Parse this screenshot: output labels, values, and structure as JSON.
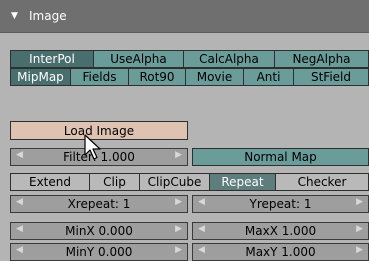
{
  "panel": {
    "title": "Image"
  },
  "row1": [
    "InterPol",
    "UseAlpha",
    "CalcAlpha",
    "NegAlpha"
  ],
  "row2": [
    "MipMap",
    "Fields",
    "Rot90",
    "Movie",
    "Anti",
    "StField"
  ],
  "load_image_label": "Load Image",
  "filter": {
    "label": "Filter: 1.000"
  },
  "normal_map_label": "Normal Map",
  "extend_modes": [
    "Extend",
    "Clip",
    "ClipCube",
    "Repeat",
    "Checker"
  ],
  "xrepeat": "Xrepeat: 1",
  "yrepeat": "Yrepeat: 1",
  "minx": "MinX 0.000",
  "maxx": "MaxX 1.000",
  "miny": "MinY 0.000",
  "maxy": "MaxY 1.000"
}
